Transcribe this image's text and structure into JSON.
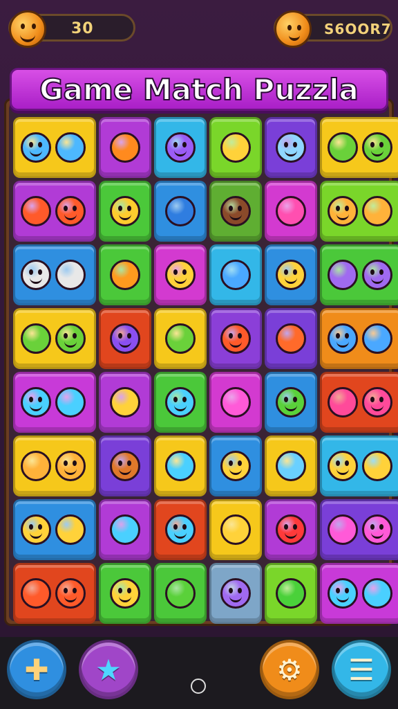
{
  "header": {
    "moves_value": "30",
    "score_value": "S6OOR7"
  },
  "title": "Game Match Puzzla",
  "board": {
    "rows": 8,
    "cols": 6,
    "tiles": [
      [
        "#f6c81b",
        "#b13bd6",
        "#33b7e8",
        "#7ad62a",
        "#7a3fd8",
        "#f6c81b"
      ],
      [
        "#b13bd6",
        "#4bc83a",
        "#2f8fe0",
        "#5fae32",
        "#d33ad0",
        "#7ad62a"
      ],
      [
        "#2f8fe0",
        "#4bc83a",
        "#d33ad0",
        "#33b7e8",
        "#2f8fe0",
        "#4bc83a"
      ],
      [
        "#f6c81b",
        "#e1461e",
        "#f6c81b",
        "#8b3fd8",
        "#7a3fd8",
        "#f08c1a"
      ],
      [
        "#c83ad8",
        "#b13bd6",
        "#4bc83a",
        "#d33ad0",
        "#2f8fe0",
        "#e1461e"
      ],
      [
        "#f6c81b",
        "#7a3fd8",
        "#f6c81b",
        "#2f8fe0",
        "#f6c81b",
        "#33b7e8"
      ],
      [
        "#2f8fe0",
        "#b13bd6",
        "#e1461e",
        "#f6c81b",
        "#b13bd6",
        "#7a3fd8"
      ],
      [
        "#e1461e",
        "#4bc83a",
        "#4bc83a",
        "#7ea6c8",
        "#7ad62a",
        "#c83ad8"
      ]
    ],
    "pieces": [
      [
        "#4db8ff",
        "#ff8a1e",
        "#9b5cf5",
        "#ffd23a",
        "#8fd6ff",
        "#6ad13a"
      ],
      [
        "#ff5a2a",
        "#ffcc2e",
        "#2f7de0",
        "#8a4a2a",
        "#ff4fb0",
        "#ffb23a"
      ],
      [
        "#e8e8e8",
        "#ff9a1e",
        "#ffd23a",
        "#4aa8ff",
        "#ffd23a",
        "#a06af0"
      ],
      [
        "#6ad13a",
        "#8a4ff0",
        "#6ad13a",
        "#ff5a2a",
        "#ff6a2a",
        "#4aa8ff"
      ],
      [
        "#4ad0ff",
        "#ffd23a",
        "#4ad0ff",
        "#ff5ad8",
        "#5ad13a",
        "#ff4a9a"
      ],
      [
        "#ffb23a",
        "#e0782a",
        "#4ad0ff",
        "#ffd23a",
        "#6ad0ff",
        "#ffd23a"
      ],
      [
        "#ffd23a",
        "#4ad0ff",
        "#4ad0ff",
        "#ffd23a",
        "#ff3a3a",
        "#ff5ad8"
      ],
      [
        "#ff5a2a",
        "#ffd23a",
        "#5ad13a",
        "#a06af0",
        "#4ad13a",
        "#4ad0ff"
      ]
    ]
  },
  "bottom_bar": {
    "buttons": [
      {
        "name": "puzzle-icon",
        "color": "#2f8fe0",
        "glyph": "✚"
      },
      {
        "name": "star-icon",
        "color": "#a046c8",
        "glyph": "★"
      },
      {
        "name": "gear-icon",
        "color": "#f08c1a",
        "glyph": "⚙"
      },
      {
        "name": "menu-icon",
        "color": "#33b7e8",
        "glyph": "☰"
      }
    ]
  }
}
